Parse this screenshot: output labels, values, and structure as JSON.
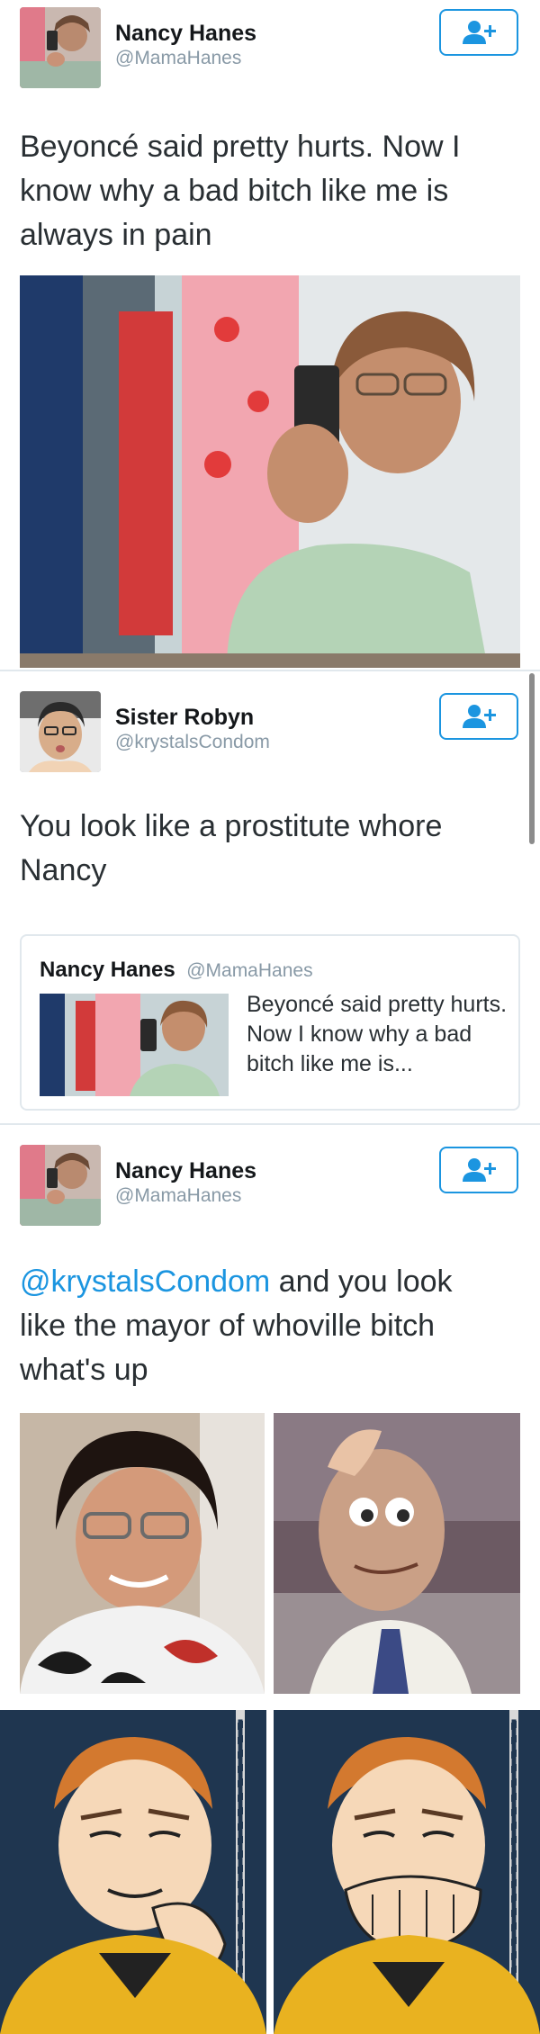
{
  "tweet1": {
    "name": "Nancy Hanes",
    "handle": "@MamaHanes",
    "text": "Beyoncé said pretty hurts. Now I know why a bad bitch like me is always in pain",
    "follow_icon": "follow-add-user-icon"
  },
  "tweet2": {
    "name": "Sister Robyn",
    "handle": "@krystalsCondom",
    "text": "You look like a prostitute whore Nancy",
    "follow_icon": "follow-add-user-icon",
    "quote": {
      "name": "Nancy Hanes",
      "handle": "@MamaHanes",
      "text": "Beyoncé said pretty hurts. Now I know why a bad bitch like me is..."
    }
  },
  "tweet3": {
    "name": "Nancy Hanes",
    "handle": "@MamaHanes",
    "mention": "@krystalsCondom",
    "text": " and you look like the mayor of whoville bitch what's up",
    "follow_icon": "follow-add-user-icon"
  },
  "colors": {
    "accent": "#1b95e0",
    "handle_gray": "#8899a6",
    "border": "#e1e8ed"
  }
}
